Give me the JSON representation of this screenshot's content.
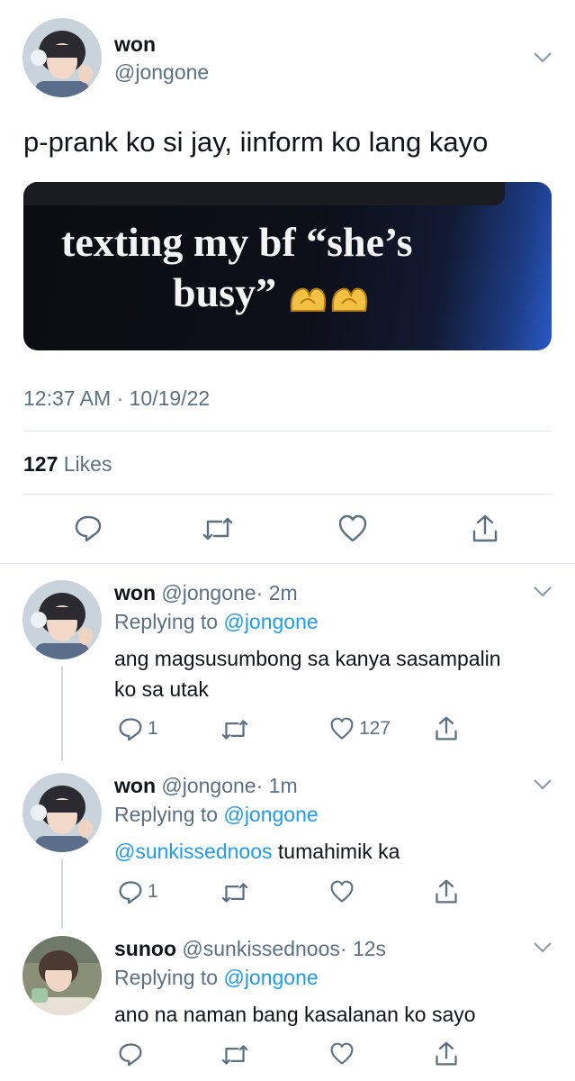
{
  "main_tweet": {
    "name": "won",
    "handle": "@jongone",
    "text": "p-prank ko si jay, iinform ko lang kayo",
    "image_caption_line1": "texting my bf “she’s",
    "image_caption_line2": "busy”",
    "timestamp": "12:37 AM · 10/19/22",
    "likes_count": "127",
    "likes_label": "Likes"
  },
  "replies": [
    {
      "name": "won",
      "handle": "@jongone",
      "time": "· 2m",
      "replying_label": "Replying to",
      "replying_handle": "@jongone",
      "text_line1": "ang magsusumbong sa kanya sasampalin",
      "text_line2": "ko sa utak",
      "reply_count": "1",
      "like_count": "127"
    },
    {
      "name": "won",
      "handle": "@jongone",
      "time": "· 1m",
      "replying_label": "Replying to",
      "replying_handle": "@jongone",
      "mention": "@sunkissednoos",
      "text_rest": " tumahimik ka",
      "reply_count": "1"
    },
    {
      "name": "sunoo",
      "handle": "@sunkissednoos",
      "time": "· 12s",
      "replying_label": "Replying to",
      "replying_handle": "@jongone",
      "text": "ano na naman bang kasalanan ko sayo"
    }
  ],
  "colors": {
    "link_blue": "#1d9bf0",
    "secondary_text": "#5b7083",
    "divider": "#e1e8ed"
  },
  "icons": [
    "chevron-down-icon",
    "reply-icon",
    "retweet-icon",
    "like-icon",
    "share-icon",
    "heart-hands-emoji"
  ]
}
